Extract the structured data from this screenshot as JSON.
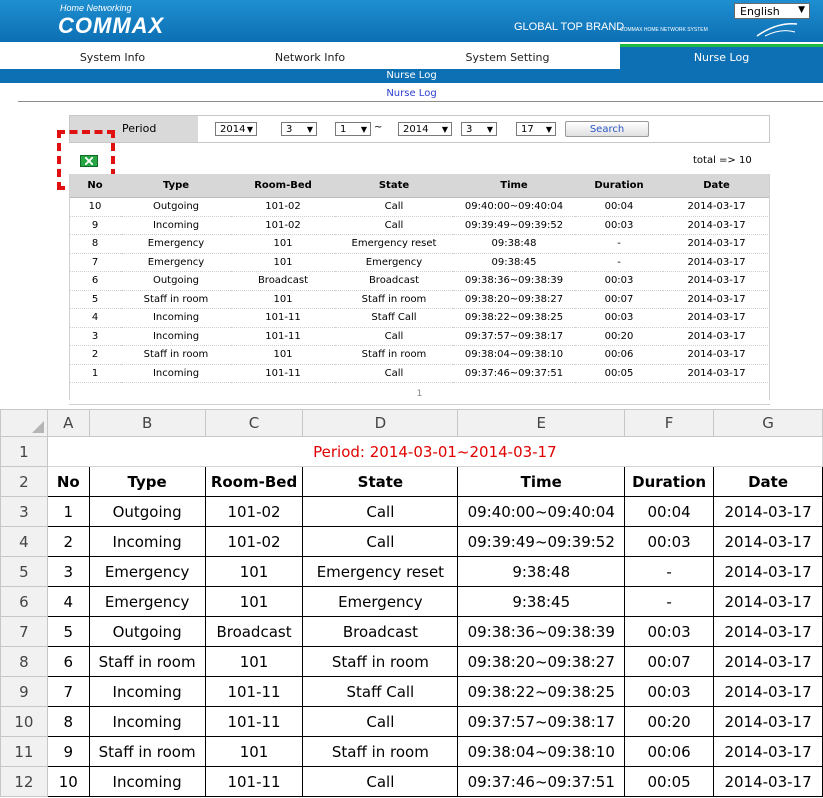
{
  "web": {
    "logo_small": "Home Networking",
    "logo_main": "COMMAX",
    "brand": "GLOBAL TOP BRAND",
    "brand_small": "COMMAX HOME NETWORK SYSTEM",
    "language": "English",
    "nav": [
      "System Info",
      "Network Info",
      "System Setting",
      "Nurse Log"
    ],
    "subbar": "Nurse Log",
    "subtitle": "Nurse Log",
    "period_label": "Period",
    "period": {
      "from_year": "2014",
      "from_month": "3",
      "from_day": "1",
      "separator": "~",
      "to_year": "2014",
      "to_month": "3",
      "to_day": "17"
    },
    "search_label": "Search",
    "total_text": "total => 10",
    "columns": [
      "No",
      "Type",
      "Room-Bed",
      "State",
      "Time",
      "Duration",
      "Date"
    ],
    "rows": [
      [
        "10",
        "Outgoing",
        "101-02",
        "Call",
        "09:40:00~09:40:04",
        "00:04",
        "2014-03-17"
      ],
      [
        "9",
        "Incoming",
        "101-02",
        "Call",
        "09:39:49~09:39:52",
        "00:03",
        "2014-03-17"
      ],
      [
        "8",
        "Emergency",
        "101",
        "Emergency reset",
        "09:38:48",
        "-",
        "2014-03-17"
      ],
      [
        "7",
        "Emergency",
        "101",
        "Emergency",
        "09:38:45",
        "-",
        "2014-03-17"
      ],
      [
        "6",
        "Outgoing",
        "Broadcast",
        "Broadcast",
        "09:38:36~09:38:39",
        "00:03",
        "2014-03-17"
      ],
      [
        "5",
        "Staff in room",
        "101",
        "Staff in room",
        "09:38:20~09:38:27",
        "00:07",
        "2014-03-17"
      ],
      [
        "4",
        "Incoming",
        "101-11",
        "Staff Call",
        "09:38:22~09:38:25",
        "00:03",
        "2014-03-17"
      ],
      [
        "3",
        "Incoming",
        "101-11",
        "Call",
        "09:37:57~09:38:17",
        "00:20",
        "2014-03-17"
      ],
      [
        "2",
        "Staff in room",
        "101",
        "Staff in room",
        "09:38:04~09:38:10",
        "00:06",
        "2014-03-17"
      ],
      [
        "1",
        "Incoming",
        "101-11",
        "Call",
        "09:37:46~09:37:51",
        "00:05",
        "2014-03-17"
      ]
    ],
    "pager": "1",
    "colors": {
      "header_blue": "#0d6fb4",
      "accent_green": "#1fb842",
      "highlight_red": "#e01010"
    }
  },
  "sheet": {
    "col_letters": [
      "A",
      "B",
      "C",
      "D",
      "E",
      "F",
      "G"
    ],
    "row_numbers": [
      "1",
      "2",
      "3",
      "4",
      "5",
      "6",
      "7",
      "8",
      "9",
      "10",
      "11",
      "12"
    ],
    "title": "Period: 2014-03-01~2014-03-17",
    "columns": [
      "No",
      "Type",
      "Room-Bed",
      "State",
      "Time",
      "Duration",
      "Date"
    ],
    "rows": [
      [
        "1",
        "Outgoing",
        "101-02",
        "Call",
        "09:40:00~09:40:04",
        "00:04",
        "2014-03-17"
      ],
      [
        "2",
        "Incoming",
        "101-02",
        "Call",
        "09:39:49~09:39:52",
        "00:03",
        "2014-03-17"
      ],
      [
        "3",
        "Emergency",
        "101",
        "Emergency reset",
        "9:38:48",
        "-",
        "2014-03-17"
      ],
      [
        "4",
        "Emergency",
        "101",
        "Emergency",
        "9:38:45",
        "-",
        "2014-03-17"
      ],
      [
        "5",
        "Outgoing",
        "Broadcast",
        "Broadcast",
        "09:38:36~09:38:39",
        "00:03",
        "2014-03-17"
      ],
      [
        "6",
        "Staff in room",
        "101",
        "Staff in room",
        "09:38:20~09:38:27",
        "00:07",
        "2014-03-17"
      ],
      [
        "7",
        "Incoming",
        "101-11",
        "Staff Call",
        "09:38:22~09:38:25",
        "00:03",
        "2014-03-17"
      ],
      [
        "8",
        "Incoming",
        "101-11",
        "Call",
        "09:37:57~09:38:17",
        "00:20",
        "2014-03-17"
      ],
      [
        "9",
        "Staff in room",
        "101",
        "Staff in room",
        "09:38:04~09:38:10",
        "00:06",
        "2014-03-17"
      ],
      [
        "10",
        "Incoming",
        "101-11",
        "Call",
        "09:37:46~09:37:51",
        "00:05",
        "2014-03-17"
      ]
    ],
    "colors": {
      "title_red": "#e00000"
    }
  }
}
